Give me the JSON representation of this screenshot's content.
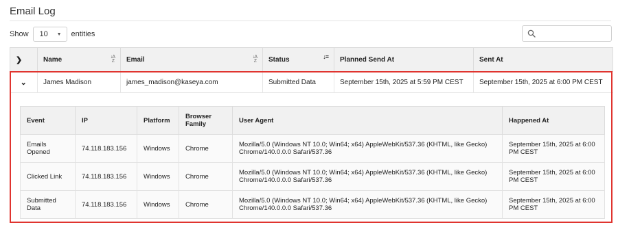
{
  "page": {
    "title": "Email Log"
  },
  "length_control": {
    "prefix": "Show",
    "value": "10",
    "suffix": "entities"
  },
  "search": {
    "placeholder": ""
  },
  "table": {
    "columns": [
      "Name",
      "Email",
      "Status",
      "Planned Send At",
      "Sent At"
    ],
    "rows": [
      {
        "name": "James Madison",
        "email": "james_madison@kaseya.com",
        "status": "Submitted Data",
        "planned_send_at": "September 15th, 2025 at 5:59 PM CEST",
        "sent_at": "September 15th, 2025 at 6:00 PM CEST"
      }
    ]
  },
  "detail_table": {
    "columns": [
      "Event",
      "IP",
      "Platform",
      "Browser Family",
      "User Agent",
      "Happened At"
    ],
    "rows": [
      {
        "event": "Emails Opened",
        "ip": "74.118.183.156",
        "platform": "Windows",
        "browser": "Chrome",
        "user_agent": "Mozilla/5.0 (Windows NT 10.0; Win64; x64) AppleWebKit/537.36 (KHTML, like Gecko) Chrome/140.0.0.0 Safari/537.36",
        "happened_at": "September 15th, 2025 at 6:00 PM CEST"
      },
      {
        "event": "Clicked Link",
        "ip": "74.118.183.156",
        "platform": "Windows",
        "browser": "Chrome",
        "user_agent": "Mozilla/5.0 (Windows NT 10.0; Win64; x64) AppleWebKit/537.36 (KHTML, like Gecko) Chrome/140.0.0.0 Safari/537.36",
        "happened_at": "September 15th, 2025 at 6:00 PM CEST"
      },
      {
        "event": "Submitted Data",
        "ip": "74.118.183.156",
        "platform": "Windows",
        "browser": "Chrome",
        "user_agent": "Mozilla/5.0 (Windows NT 10.0; Win64; x64) AppleWebKit/537.36 (KHTML, like Gecko) Chrome/140.0.0.0 Safari/537.36",
        "happened_at": "September 15th, 2025 at 6:00 PM CEST"
      }
    ]
  },
  "colors": {
    "highlight_border": "#e0342f",
    "expand_caret": "#1f6fb5",
    "header_bg": "#f1f1f1"
  },
  "icons": {
    "expand_all": "chevron-right-icon",
    "row_expanded": "chevron-down-icon",
    "search": "search-icon"
  }
}
